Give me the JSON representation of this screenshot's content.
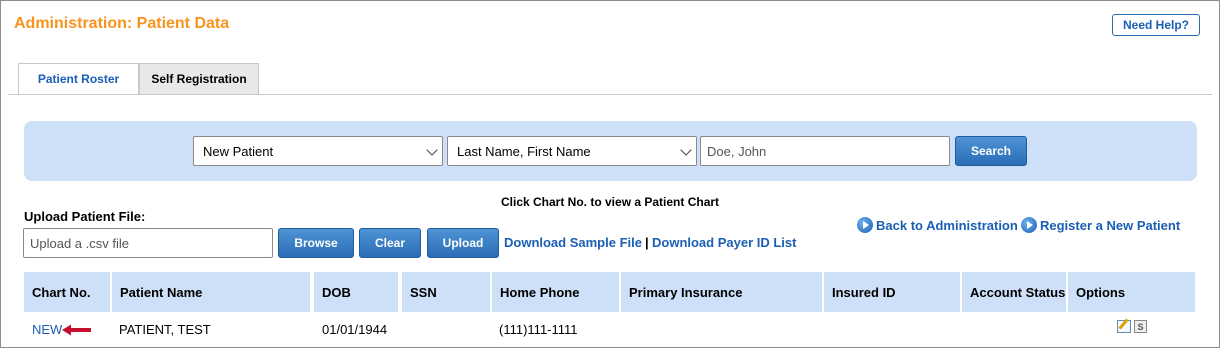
{
  "header": {
    "title": "Administration: Patient Data",
    "help_label": "Need Help?"
  },
  "tabs": [
    {
      "label": "Patient Roster",
      "active": true
    },
    {
      "label": "Self Registration",
      "active": false
    }
  ],
  "search": {
    "type_value": "New Patient",
    "order_value": "Last Name, First Name",
    "name_placeholder": "Doe, John",
    "button_label": "Search"
  },
  "hint": "Click Chart No. to view a Patient Chart",
  "upload": {
    "label": "Upload Patient File:",
    "placeholder": "Upload a .csv file",
    "browse_label": "Browse",
    "clear_label": "Clear",
    "upload_label": "Upload",
    "sample_link": "Download Sample File",
    "separator": "|",
    "payer_link": "Download Payer ID List"
  },
  "nav_links": {
    "back": "Back to Administration",
    "register": "Register a New Patient"
  },
  "table": {
    "headers": [
      "Chart No.",
      "Patient Name",
      "DOB",
      "SSN",
      "Home Phone",
      "Primary Insurance",
      "Insured ID",
      "Account Status",
      "Options"
    ],
    "rows": [
      {
        "chart_no": "NEW",
        "patient_name": "PATIENT, TEST",
        "dob": "01/01/1944",
        "ssn": "",
        "home_phone": "(111)111-1111",
        "primary_insurance": "",
        "insured_id": "",
        "account_status": ""
      }
    ]
  },
  "icons": {
    "edit": "edit-icon",
    "statement": "statement-icon",
    "arrow": "red-arrow-icon"
  },
  "colors": {
    "title": "#f7941d",
    "link": "#1a5fb4",
    "panel": "#cde0f7",
    "arrow": "#c8102e"
  }
}
